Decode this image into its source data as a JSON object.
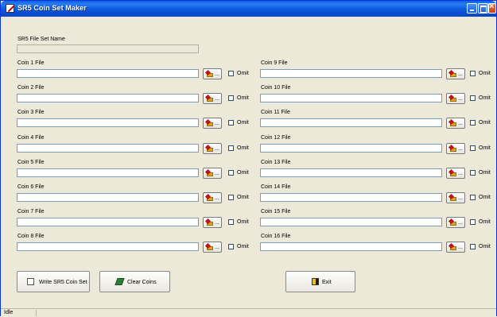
{
  "window": {
    "title": "SR5 Coin Set Maker"
  },
  "set_name": {
    "label": "SR5 File Set Name",
    "value": ""
  },
  "browse_button": {
    "label": "..."
  },
  "omit_label": "Omit",
  "coins": [
    {
      "label": "Coin 1 File",
      "value": "",
      "omit": false
    },
    {
      "label": "Coin 2 File",
      "value": "",
      "omit": false
    },
    {
      "label": "Coin 3 File",
      "value": "",
      "omit": false
    },
    {
      "label": "Coin 4 File",
      "value": "",
      "omit": false
    },
    {
      "label": "Coin 5 File",
      "value": "",
      "omit": false
    },
    {
      "label": "Coin 6 File",
      "value": "",
      "omit": false
    },
    {
      "label": "Coin 7 File",
      "value": "",
      "omit": false
    },
    {
      "label": "Coin 8 File",
      "value": "",
      "omit": false
    },
    {
      "label": "Coin 9 File",
      "value": "",
      "omit": false
    },
    {
      "label": "Coin 10 File",
      "value": "",
      "omit": false
    },
    {
      "label": "Coin 11 File",
      "value": "",
      "omit": false
    },
    {
      "label": "Coin 12 File",
      "value": "",
      "omit": false
    },
    {
      "label": "Coin 13 File",
      "value": "",
      "omit": false
    },
    {
      "label": "Coin 14 File",
      "value": "",
      "omit": false
    },
    {
      "label": "Coin 15 File",
      "value": "",
      "omit": false
    },
    {
      "label": "Coin 16 File",
      "value": "",
      "omit": false
    }
  ],
  "actions": {
    "write": "Write SR5 Coin Set",
    "clear": "Clear Coins",
    "exit": "Exit"
  },
  "status": "Idle"
}
